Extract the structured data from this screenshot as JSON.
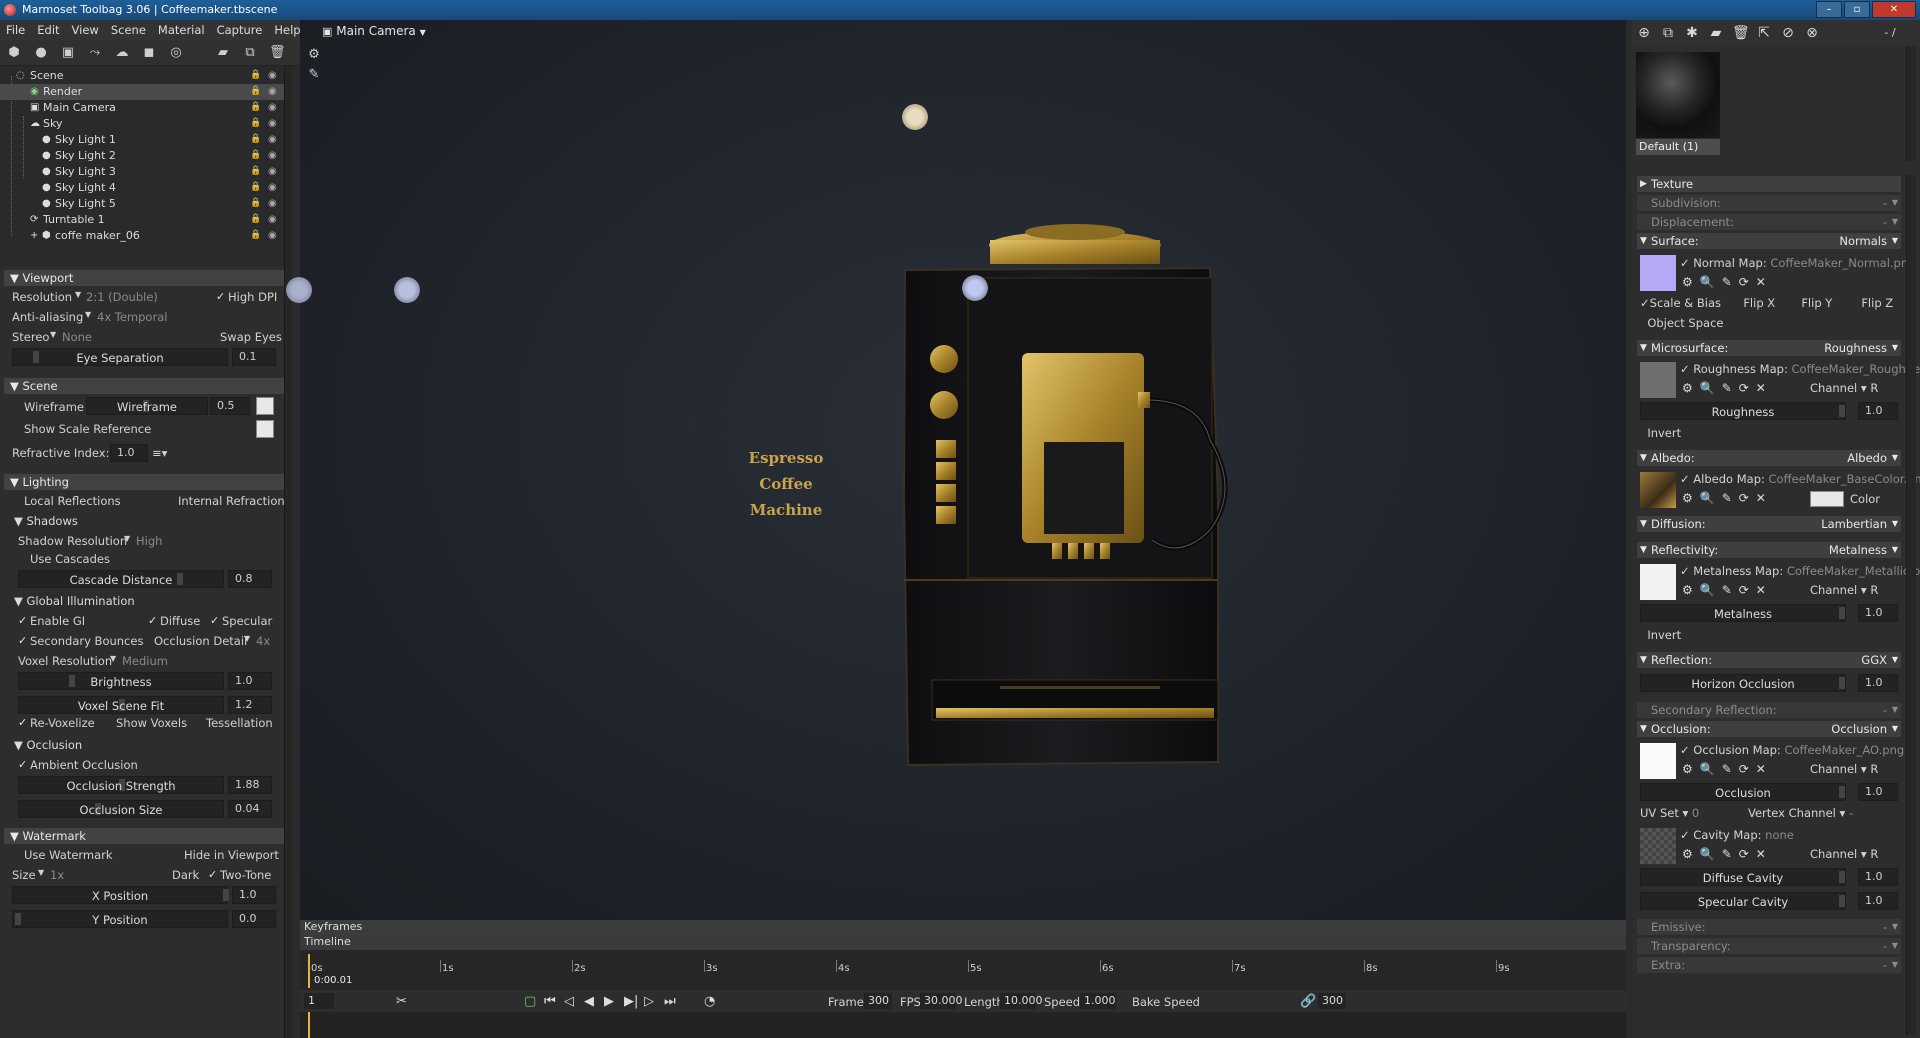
{
  "window": {
    "title": "Marmoset Toolbag 3.06  |  Coffeemaker.tbscene",
    "buttons": [
      "–",
      "▫",
      "✕"
    ]
  },
  "menu": [
    "File",
    "Edit",
    "View",
    "Scene",
    "Material",
    "Capture",
    "Help"
  ],
  "left_toolbar_icons": [
    "mesh-icon",
    "light-icon",
    "camera-icon",
    "turntable-icon",
    "fog-icon",
    "shadow-catcher-icon",
    "sky-icon",
    "folder-icon",
    "duplicate-icon",
    "delete-icon"
  ],
  "scene_tree": [
    {
      "label": "Scene",
      "icon": "scene-icon"
    },
    {
      "label": "Render",
      "icon": "render-icon",
      "selected": true
    },
    {
      "label": "Main Camera",
      "icon": "camera-icon"
    },
    {
      "label": "Sky",
      "icon": "sky-icon"
    },
    {
      "label": "Sky Light 1",
      "icon": "light-icon"
    },
    {
      "label": "Sky Light 2",
      "icon": "light-icon"
    },
    {
      "label": "Sky Light 3",
      "icon": "light-icon"
    },
    {
      "label": "Sky Light 4",
      "icon": "light-icon"
    },
    {
      "label": "Sky Light 5",
      "icon": "light-icon"
    },
    {
      "label": "Turntable 1",
      "icon": "turntable-icon"
    },
    {
      "label": "coffe maker_06",
      "icon": "mesh-icon"
    }
  ],
  "viewport_section": {
    "title": "Viewport",
    "resolution_label": "Resolution",
    "resolution_value": "2:1 (Double)",
    "high_dpi": "High DPI",
    "antialiasing_label": "Anti-aliasing",
    "antialiasing_value": "4x Temporal",
    "stereo_label": "Stereo",
    "stereo_value": "None",
    "swap_eyes": "Swap Eyes",
    "eye_separation": "Eye Separation",
    "eye_separation_value": "0.1"
  },
  "scene_section": {
    "title": "Scene",
    "wireframe": "Wireframe",
    "wireframe_slider": "Wireframe",
    "wireframe_value": "0.5",
    "show_scale": "Show Scale Reference",
    "refractive_label": "Refractive Index:",
    "refractive_value": "1.0"
  },
  "lighting_section": {
    "title": "Lighting",
    "local_reflections": "Local Reflections",
    "internal_refraction": "Internal Refraction",
    "shadows": "Shadows",
    "shadow_resolution_label": "Shadow Resolution",
    "shadow_resolution_value": "High",
    "use_cascades": "Use Cascades",
    "cascade_distance": "Cascade Distance",
    "cascade_distance_value": "0.8",
    "gi": "Global Illumination",
    "enable_gi": "Enable GI",
    "diffuse": "Diffuse",
    "specular": "Specular",
    "secondary_bounces": "Secondary Bounces",
    "occlusion_detail_label": "Occlusion Detail",
    "occlusion_detail_value": "4x",
    "voxel_resolution_label": "Voxel Resolution",
    "voxel_resolution_value": "Medium",
    "brightness": "Brightness",
    "brightness_value": "1.0",
    "voxel_scene_fit": "Voxel Scene Fit",
    "voxel_scene_fit_value": "1.2",
    "revoxelize": "Re-Voxelize",
    "show_voxels": "Show Voxels",
    "tessellation": "Tessellation",
    "occlusion": "Occlusion",
    "ambient_occlusion": "Ambient Occlusion",
    "occlusion_strength": "Occlusion Strength",
    "occlusion_strength_value": "1.88",
    "occlusion_size": "Occlusion Size",
    "occlusion_size_value": "0.04"
  },
  "watermark_section": {
    "title": "Watermark",
    "use_watermark": "Use Watermark",
    "hide_in_viewport": "Hide in Viewport",
    "size_label": "Size",
    "size_value": "1x",
    "dark": "Dark",
    "two_tone": "Two-Tone",
    "x_position": "X Position",
    "x_position_value": "1.0",
    "y_position": "Y Position",
    "y_position_value": "0.0"
  },
  "viewport": {
    "camera_label": "Main Camera",
    "machine_text": [
      "Espresso",
      "Coffee",
      "Machine"
    ]
  },
  "timeline": {
    "keyframes": "Keyframes",
    "timeline": "Timeline",
    "current_time": "0:00.01",
    "ticks": [
      "0s",
      "1s",
      "2s",
      "3s",
      "4s",
      "5s",
      "6s",
      "7s",
      "8s",
      "9s"
    ],
    "frame_field": "1",
    "frames_label": "Frames",
    "frames_value": "300",
    "fps_label": "FPS",
    "fps_value": "30.000",
    "length_label": "Length",
    "length_value": "10.000",
    "speed_label": "Speed",
    "speed_value": "1.000",
    "bake_speed": "Bake Speed",
    "end_frame": "300"
  },
  "material": {
    "name": "Default (1)",
    "toolbar_value": "- /",
    "sections": {
      "texture": "Texture",
      "subdivision": "Subdivision:",
      "displacement": "Displacement:",
      "surface": "Surface:",
      "surface_value": "Normals",
      "normal_map_label": "Normal Map:",
      "normal_map_file": "CoffeeMaker_Normal.png",
      "scale_bias": "Scale & Bias",
      "flip_x": "Flip X",
      "flip_y": "Flip Y",
      "flip_z": "Flip Z",
      "object_space": "Object Space",
      "microsurface": "Microsurface:",
      "microsurface_value": "Roughness",
      "roughness_map_label": "Roughness Map:",
      "roughness_map_file": "CoffeeMaker_Roughne",
      "channel": "Channel",
      "channel_value": "R",
      "roughness": "Roughness",
      "roughness_value": "1.0",
      "invert": "Invert",
      "albedo": "Albedo:",
      "albedo_value": "Albedo",
      "albedo_map_label": "Albedo Map:",
      "albedo_map_file": "CoffeeMaker_BaseColor.pn",
      "color": "Color",
      "diffusion": "Diffusion:",
      "diffusion_value": "Lambertian",
      "reflectivity": "Reflectivity:",
      "reflectivity_value": "Metalness",
      "metalness_map_label": "Metalness Map:",
      "metalness_map_file": "CoffeeMaker_Metallic.p",
      "metalness": "Metalness",
      "metalness_value": "1.0",
      "reflection": "Reflection:",
      "reflection_value": "GGX",
      "horizon_occlusion": "Horizon Occlusion",
      "horizon_occlusion_value": "1.0",
      "secondary_reflection": "Secondary Reflection:",
      "occlusion": "Occlusion:",
      "occlusion_value": "Occlusion",
      "occlusion_map_label": "Occlusion Map:",
      "occlusion_map_file": "CoffeeMaker_AO.png",
      "occlusion_slider": "Occlusion",
      "occlusion_slider_value": "1.0",
      "uv_set_label": "UV Set",
      "uv_set_value": "0",
      "vertex_channel": "Vertex Channel",
      "vertex_channel_value": "-",
      "cavity_map_label": "Cavity Map:",
      "cavity_map_file": "none",
      "diffuse_cavity": "Diffuse Cavity",
      "diffuse_cavity_value": "1.0",
      "specular_cavity": "Specular Cavity",
      "specular_cavity_value": "1.0",
      "emissive": "Emissive:",
      "transparency": "Transparency:",
      "extra": "Extra:",
      "dash": "-"
    }
  },
  "colors": {
    "normal_map": "#b3a9f6",
    "accent": "#1f5f9a",
    "gold": "#b8962d"
  }
}
